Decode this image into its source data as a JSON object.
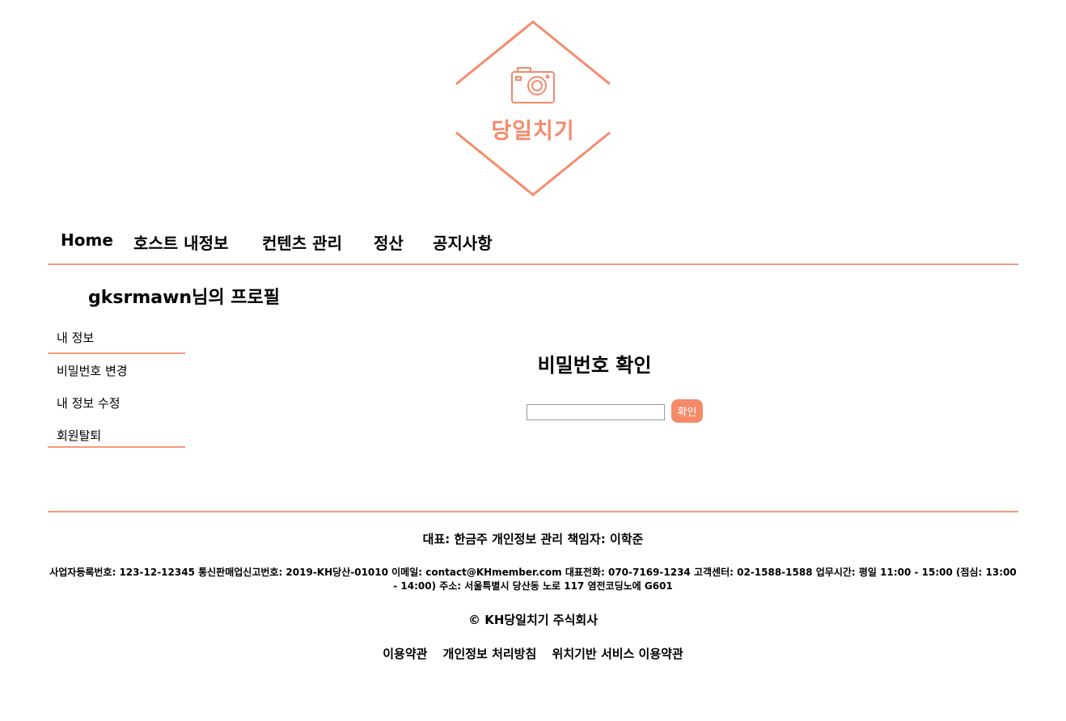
{
  "brand": {
    "logo_text": "당일치기",
    "accent_color": "#f58a6b",
    "logo_icon": "camera-icon"
  },
  "nav": {
    "items": [
      {
        "label": "Home"
      },
      {
        "label": "호스트 내정보"
      },
      {
        "label": "컨텐츠 관리"
      },
      {
        "label": "정산"
      },
      {
        "label": "공지사항"
      }
    ]
  },
  "profile": {
    "title": "gksrmawn님의 프로필"
  },
  "sidebar": {
    "heading": "내 정보",
    "items": [
      {
        "label": "비밀번호 변경"
      },
      {
        "label": "내 정보 수정"
      },
      {
        "label": "회원탈퇴"
      }
    ]
  },
  "password_check": {
    "title": "비밀번호 확인",
    "input_value": "",
    "button_label": "확인"
  },
  "footer": {
    "representative": "대표: 한금주 개인정보 관리 책임자: 이학준",
    "info": "사업자등록번호: 123-12-12345 통신판매업신고번호: 2019-KH당산-01010 이메일: contact@KHmember.com 대표전화: 070-7169-1234 고객센터: 02-1588-1588 업무시간: 평일 11:00 - 15:00 (점심: 13:00 - 14:00) 주소: 서울특별시 당산동 노로 117 염전코딩노에 G601",
    "copyright": "© KH당일치기 주식회사",
    "links": [
      {
        "label": "이용약관"
      },
      {
        "label": "개인정보 처리방침"
      },
      {
        "label": "위치기반 서비스 이용약관"
      }
    ]
  }
}
